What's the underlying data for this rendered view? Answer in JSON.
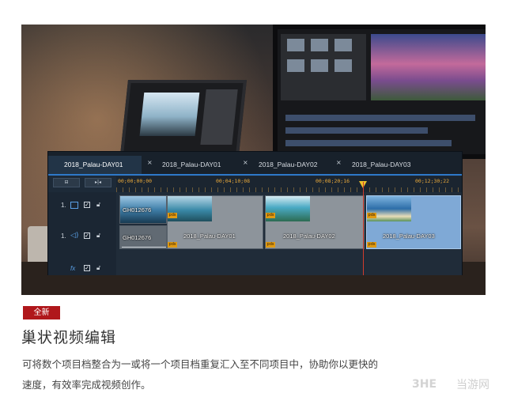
{
  "editor": {
    "tabs": [
      {
        "label": "2018_Palau-DAY01",
        "active": true
      },
      {
        "label": "2018_Palau-DAY01",
        "active": false
      },
      {
        "label": "2018_Palau-DAY02",
        "active": false
      },
      {
        "label": "2018_Palau-DAY03",
        "active": false
      }
    ],
    "close_glyph": "×",
    "timecodes": [
      "00;00;00;00",
      "00;04;10;08",
      "00;08;20;16",
      "00;12;30;22"
    ],
    "tracks": [
      {
        "number": "1.",
        "type": "video-track-icon"
      },
      {
        "number": "1.",
        "type": "audio-track-icon"
      },
      {
        "number": "fx",
        "type": "fx-track-icon"
      }
    ],
    "clips": {
      "first_video_label": "GH012676",
      "first_audio_label": "GH012676",
      "group_labels": [
        "2018_Palau-DAY01",
        "2018_Palau-DAY02",
        "2018_Palau-DAY03"
      ],
      "pds_label": "pds"
    }
  },
  "feature": {
    "badge": "全新",
    "title": "巢状视频编辑",
    "description_line1": "可将数个项目档整合为一或将一个项目档重复汇入至不同项目中，协助你以更快的",
    "description_line2": "速度，有效率完成视频创作。"
  },
  "watermark": {
    "brand": "3HE",
    "site": "当游网"
  },
  "colors": {
    "badge": "#b0171b",
    "accent_blue": "#2e78c8",
    "timecode": "#e8a83a",
    "playhead": "#d23c2c"
  }
}
